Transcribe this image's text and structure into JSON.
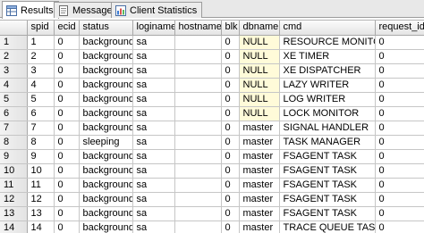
{
  "tabs": [
    {
      "label": "Results",
      "icon": "results-grid-icon",
      "active": true
    },
    {
      "label": "Messages",
      "icon": "messages-icon",
      "active": false
    },
    {
      "label": "Client Statistics",
      "icon": "client-statistics-icon",
      "active": false
    }
  ],
  "grid": {
    "columns": [
      "spid",
      "ecid",
      "status",
      "loginame",
      "hostname",
      "blk",
      "dbname",
      "cmd",
      "request_id"
    ],
    "rows": [
      {
        "n": "1",
        "spid": "1",
        "ecid": "0",
        "status": "background",
        "loginame": "sa",
        "hostname": "",
        "blk": "0",
        "dbname": "NULL",
        "cmd": "RESOURCE MONITOR",
        "request_id": "0"
      },
      {
        "n": "2",
        "spid": "2",
        "ecid": "0",
        "status": "background",
        "loginame": "sa",
        "hostname": "",
        "blk": "0",
        "dbname": "NULL",
        "cmd": "XE TIMER",
        "request_id": "0"
      },
      {
        "n": "3",
        "spid": "3",
        "ecid": "0",
        "status": "background",
        "loginame": "sa",
        "hostname": "",
        "blk": "0",
        "dbname": "NULL",
        "cmd": "XE DISPATCHER",
        "request_id": "0"
      },
      {
        "n": "4",
        "spid": "4",
        "ecid": "0",
        "status": "background",
        "loginame": "sa",
        "hostname": "",
        "blk": "0",
        "dbname": "NULL",
        "cmd": "LAZY WRITER",
        "request_id": "0"
      },
      {
        "n": "5",
        "spid": "5",
        "ecid": "0",
        "status": "background",
        "loginame": "sa",
        "hostname": "",
        "blk": "0",
        "dbname": "NULL",
        "cmd": "LOG WRITER",
        "request_id": "0"
      },
      {
        "n": "6",
        "spid": "6",
        "ecid": "0",
        "status": "background",
        "loginame": "sa",
        "hostname": "",
        "blk": "0",
        "dbname": "NULL",
        "cmd": "LOCK MONITOR",
        "request_id": "0"
      },
      {
        "n": "7",
        "spid": "7",
        "ecid": "0",
        "status": "background",
        "loginame": "sa",
        "hostname": "",
        "blk": "0",
        "dbname": "master",
        "cmd": "SIGNAL HANDLER",
        "request_id": "0"
      },
      {
        "n": "8",
        "spid": "8",
        "ecid": "0",
        "status": "sleeping",
        "loginame": "sa",
        "hostname": "",
        "blk": "0",
        "dbname": "master",
        "cmd": "TASK MANAGER",
        "request_id": "0"
      },
      {
        "n": "9",
        "spid": "9",
        "ecid": "0",
        "status": "background",
        "loginame": "sa",
        "hostname": "",
        "blk": "0",
        "dbname": "master",
        "cmd": "FSAGENT TASK",
        "request_id": "0"
      },
      {
        "n": "10",
        "spid": "10",
        "ecid": "0",
        "status": "background",
        "loginame": "sa",
        "hostname": "",
        "blk": "0",
        "dbname": "master",
        "cmd": "FSAGENT TASK",
        "request_id": "0"
      },
      {
        "n": "11",
        "spid": "11",
        "ecid": "0",
        "status": "background",
        "loginame": "sa",
        "hostname": "",
        "blk": "0",
        "dbname": "master",
        "cmd": "FSAGENT TASK",
        "request_id": "0"
      },
      {
        "n": "12",
        "spid": "12",
        "ecid": "0",
        "status": "background",
        "loginame": "sa",
        "hostname": "",
        "blk": "0",
        "dbname": "master",
        "cmd": "FSAGENT TASK",
        "request_id": "0"
      },
      {
        "n": "13",
        "spid": "13",
        "ecid": "0",
        "status": "background",
        "loginame": "sa",
        "hostname": "",
        "blk": "0",
        "dbname": "master",
        "cmd": "FSAGENT TASK",
        "request_id": "0"
      },
      {
        "n": "14",
        "spid": "14",
        "ecid": "0",
        "status": "background",
        "loginame": "sa",
        "hostname": "",
        "blk": "0",
        "dbname": "master",
        "cmd": "TRACE QUEUE TASK",
        "request_id": "0"
      }
    ]
  },
  "colors": {
    "null_cell": "#fffbd9",
    "header": "#e4e4e4"
  }
}
